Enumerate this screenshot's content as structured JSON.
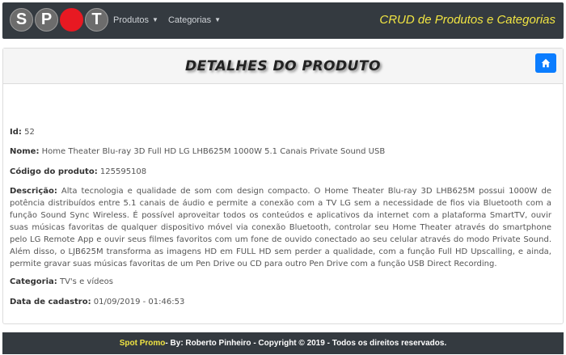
{
  "navbar": {
    "logo_letters": [
      "S",
      "P",
      "",
      "T"
    ],
    "menu": [
      {
        "label": "Produtos"
      },
      {
        "label": "Categorias"
      }
    ],
    "brand": "CRUD de Produtos e Categorias"
  },
  "card": {
    "title": "DETALHES DO PRODUTO",
    "home_icon": "home-icon"
  },
  "product": {
    "id_label": "Id:",
    "id": "52",
    "name_label": "Nome:",
    "name": "Home Theater Blu-ray 3D Full HD LG LHB625M 1000W 5.1 Canais Private Sound USB",
    "code_label": "Código do produto:",
    "code": "125595108",
    "desc_label": "Descrição:",
    "description": "Alta tecnologia e qualidade de som com design compacto. O Home Theater Blu-ray 3D LHB625M possui 1000W de potência distribuídos entre 5.1 canais de áudio e permite a conexão com a TV LG sem a necessidade de fios via Bluetooth com a função Sound Sync Wireless. É possível aproveitar todos os conteúdos e aplicativos da internet com a plataforma SmartTV, ouvir suas músicas favoritas de qualquer dispositivo móvel via conexão Bluetooth, controlar seu Home Theater através do smartphone pelo LG Remote App e ouvir seus filmes favoritos com um fone de ouvido conectado ao seu celular através do modo Private Sound. Além disso, o LJB625M transforma as imagens HD em FULL HD sem perder a qualidade, com a função Full HD Upscalling, e ainda, permite gravar suas músicas favoritas de um Pen Drive ou CD para outro Pen Drive com a função USB Direct Recording.",
    "category_label": "Categoria:",
    "category": "TV's e vídeos",
    "date_label": "Data de cadastro:",
    "date": "01/09/2019 - 01:46:53"
  },
  "footer": {
    "promo": "Spot Promo",
    "text": " - By: Roberto Pinheiro - Copyright © 2019 - Todos os direitos reservados."
  },
  "colors": {
    "navbar_bg": "#343a40",
    "brand_yellow": "#f0e442",
    "logo_red": "#e81922",
    "button_blue": "#0b7dff"
  }
}
